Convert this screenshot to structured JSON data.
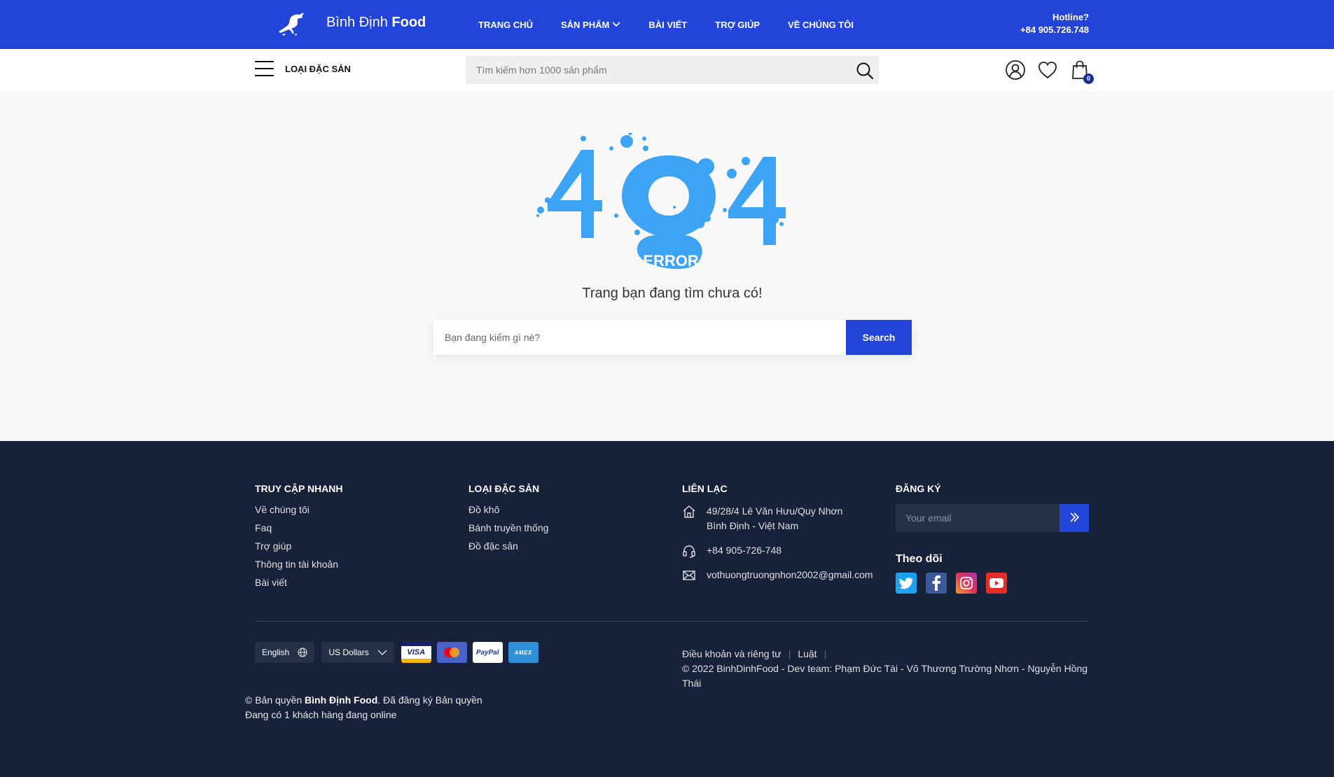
{
  "brand": {
    "name_light": "Bình Định",
    "name_bold": "Food"
  },
  "nav": {
    "items": [
      {
        "label": "TRANG CHỦ"
      },
      {
        "label": "SẢN PHẨM"
      },
      {
        "label": "BÀI VIẾT"
      },
      {
        "label": "TRỢ GIÚP"
      },
      {
        "label": "VỀ CHÚNG TÔI"
      }
    ]
  },
  "hotline": {
    "title": "Hotline?",
    "number": "+84 905.726.748"
  },
  "subbar": {
    "category_label": "LOẠI ĐẶC SẢN",
    "search_placeholder": "Tìm kiếm hơn 1000 sản phẩm",
    "cart_count": "0"
  },
  "error": {
    "code_text": "404",
    "error_word": "ERROR",
    "message": "Trang bạn đang tìm chưa có!",
    "search_placeholder": "Bạn đang kiếm gì nè?",
    "search_button": "Search"
  },
  "footer": {
    "quick_access": {
      "title": "TRUY CẬP NHANH",
      "links": [
        "Về chúng tôi",
        "Faq",
        "Trợ giúp",
        "Thông tin tài khoản",
        "Bài viết"
      ]
    },
    "categories": {
      "title": "LOẠI ĐẶC SẢN",
      "links": [
        "Đồ khô",
        "Bánh truyền thống",
        "Đồ đặc sản"
      ]
    },
    "contact": {
      "title": "LIÊN LẠC",
      "address_line1": "49/28/4 Lê Văn Hưu/Quy Nhơn",
      "address_line2": "Bình Định - Việt Nam",
      "phone": "+84 905-726-748",
      "email": "vothuongtruongnhon2002@gmail.com"
    },
    "subscribe": {
      "title": "ĐĂNG KÝ",
      "placeholder": "Your email",
      "follow_title": "Theo dõi"
    },
    "language": "English",
    "currency": "US Dollars",
    "cards": [
      "VISA",
      "PayPal",
      "AMEX"
    ],
    "copyright_prefix": "© Bản quyền ",
    "copyright_brand": "Bình Định Food",
    "copyright_suffix": ". Đã đăng ký Bản quyền",
    "online_text": "Đang có 1 khách hàng đang online",
    "legal_links": [
      "Điều khoản và riêng tư",
      "Luật"
    ],
    "credits": "© 2022 BinhDinhFood - Dev team: Phạm Đức Tài - Võ Thương Trường Nhơn - Nguyễn Hồng Thái"
  },
  "colors": {
    "primary": "#2344d9",
    "footer_bg": "#17213a",
    "error_blue": "#3da3f5"
  }
}
